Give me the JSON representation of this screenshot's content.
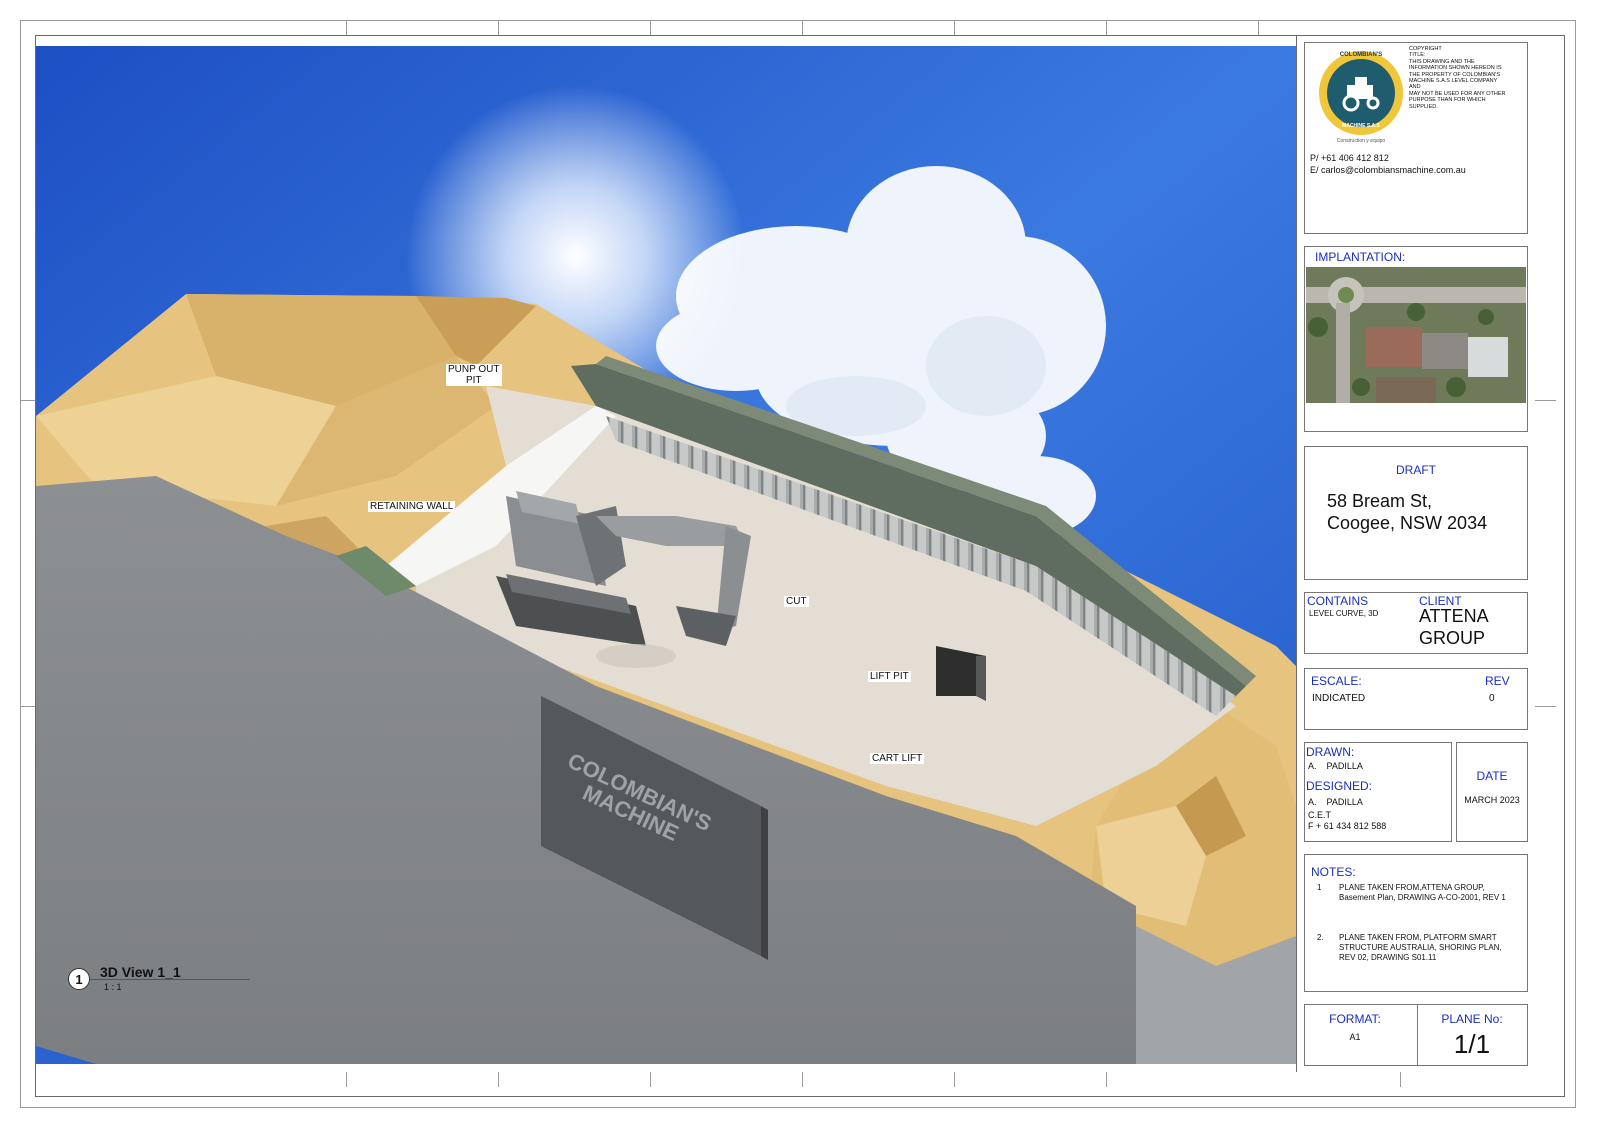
{
  "view": {
    "labels": {
      "punp_out_pit": "PUNP OUT\nPIT",
      "retaining_wall": "RETAINING WALL",
      "cut": "CUT",
      "lift_pit": "LIFT PIT",
      "cart_lift": "CART LIFT"
    },
    "sign_text_line1": "COLOMBIAN'S",
    "sign_text_line2": "MACHINE",
    "title_number": "1",
    "title_name": "3D View 1_1",
    "title_scale": "1 : 1"
  },
  "titleblock": {
    "logo_text_top": "COLOMBIAN'S",
    "logo_text_bottom": "MACHINE S.A.S",
    "logo_tagline": "Construction y equipo",
    "copyright": "COPYRIGHT\nTITLE:\nTHIS DRAWING AND THE\nINFORMATION SHOWN HEREON IS\nTHE PROPERTY OF COLOMBIAN'S\nMACHINE S.A.S LEVEL COMPANY\nAND\nMAY NOT BE USED FOR ANY OTHER\nPURPOSE THAN FOR WHICH\nSUPPLIED.",
    "phone": "P/ +61 406 412 812",
    "email": "E/ carlos@colombiansmachine.com.au",
    "implantation_label": "IMPLANTATION:",
    "draft_label": "DRAFT",
    "address_line1": "58 Bream St,",
    "address_line2": "Coogee, NSW 2034",
    "contains_label": "CONTAINS",
    "contains_value": "LEVEL CURVE, 3D",
    "client_label": "CLIENT",
    "client_value_line1": "ATTENA",
    "client_value_line2": "GROUP",
    "escale_label": "ESCALE:",
    "escale_value": "INDICATED",
    "rev_label": "REV",
    "rev_value": "0",
    "drawn_label": "DRAWN:",
    "drawn_value": "A.    PADILLA",
    "designed_label": "DESIGNED:",
    "designed_value": "A.    PADILLA",
    "designed_company": "C.E.T",
    "designed_phone": "F + 61 434 812 588",
    "date_label": "DATE",
    "date_value": "MARCH 2023",
    "notes_label": "NOTES:",
    "note1_num": "1",
    "note1_text": "PLANE TAKEN FROM,ATTENA GROUP, Basement Plan, DRAWING A-CO-2001, REV 1",
    "note2_num": "2.",
    "note2_text": "PLANE TAKEN FROM, PLATFORM SMART STRUCTURE AUSTRALIA, SHORING PLAN, REV 02, DRAWING S01.11",
    "format_label": "FORMAT:",
    "format_value": "A1",
    "plane_label": "PLANE No:",
    "plane_value": "1/1"
  },
  "colors": {
    "sky": "#2f6fd8",
    "sand": "#e6c37e",
    "ground": "#8a8d90",
    "floor": "#e3ddd4",
    "accent_blue": "#1a2fbf"
  }
}
